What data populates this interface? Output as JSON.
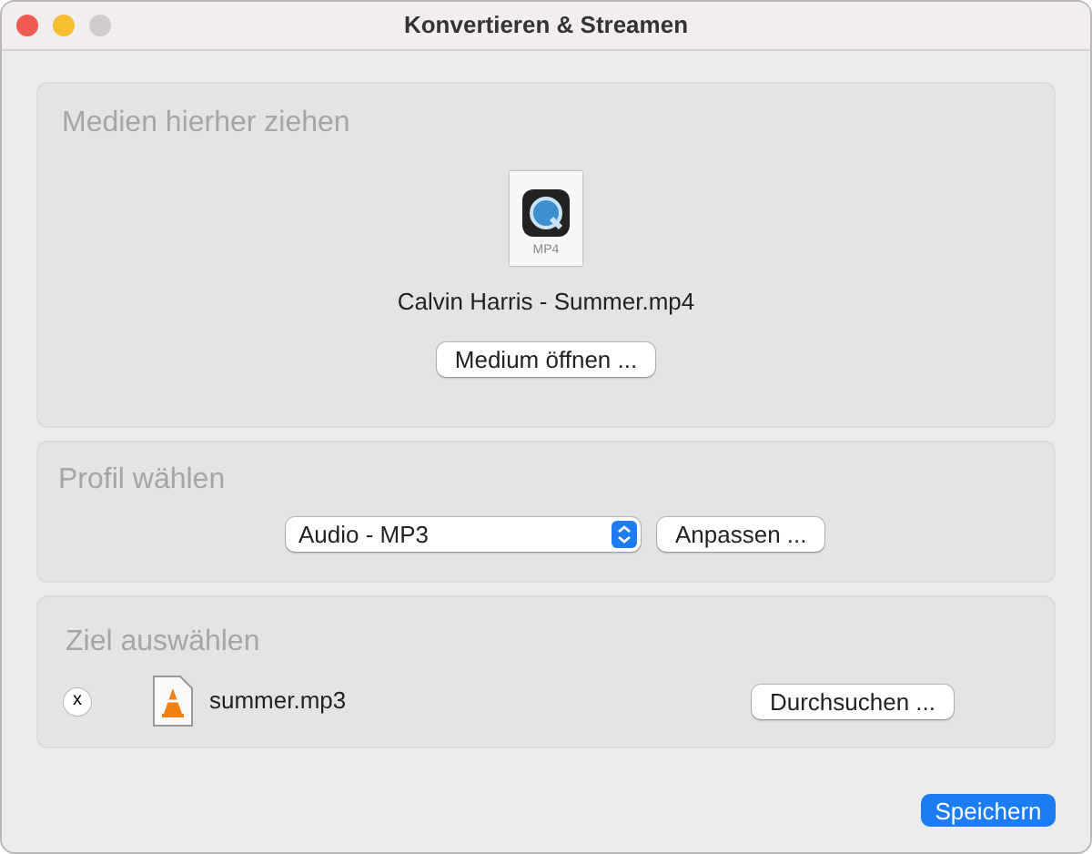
{
  "window": {
    "title": "Konvertieren & Streamen"
  },
  "media": {
    "heading": "Medien hierher ziehen",
    "file_type": "MP4",
    "file_name": "Calvin Harris - Summer.mp4",
    "open_button": "Medium öffnen ..."
  },
  "profile": {
    "heading": "Profil wählen",
    "select_value": "Audio - MP3",
    "customize_button": "Anpassen ..."
  },
  "destination": {
    "heading": "Ziel auswählen",
    "clear_button": "x",
    "file_name": "summer.mp3",
    "browse_button": "Durchsuchen ..."
  },
  "save_button": "Speichern"
}
